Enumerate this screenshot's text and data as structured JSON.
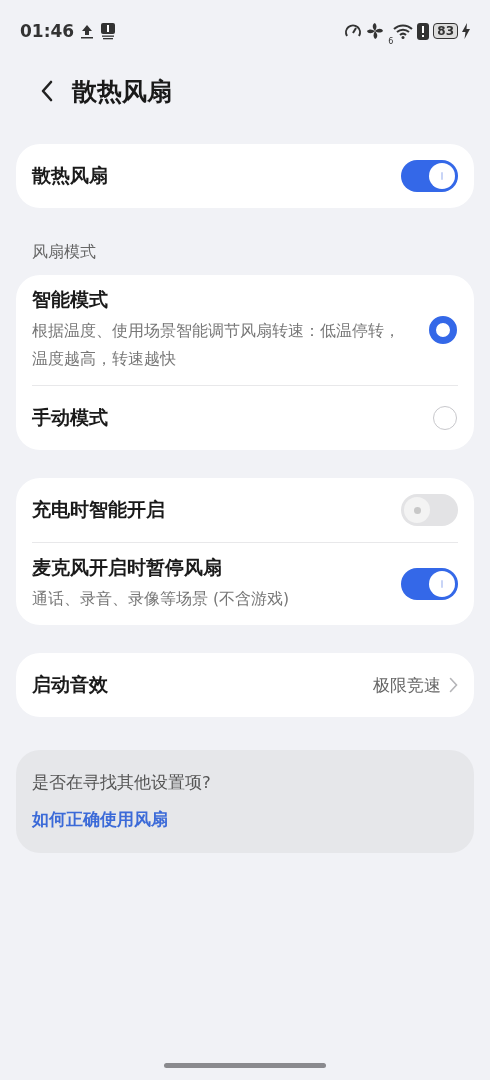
{
  "status_bar": {
    "time": "01:46",
    "wifi_badge": "6",
    "battery": "83"
  },
  "header": {
    "title": "散热风扇"
  },
  "master": {
    "label": "散热风扇",
    "on": true
  },
  "mode_section": {
    "title": "风扇模式",
    "options": [
      {
        "label": "智能模式",
        "description": "根据温度、使用场景智能调节风扇转速：低温停转，温度越高，转速越快",
        "selected": true
      },
      {
        "label": "手动模式",
        "selected": false
      }
    ]
  },
  "switches": [
    {
      "label": "充电时智能开启",
      "on": false
    },
    {
      "label": "麦克风开启时暂停风扇",
      "description": "通话、录音、录像等场景 (不含游戏)",
      "on": true
    }
  ],
  "sound": {
    "label": "启动音效",
    "value": "极限竞速"
  },
  "help": {
    "question": "是否在寻找其他设置项?",
    "link": "如何正确使用风扇"
  }
}
